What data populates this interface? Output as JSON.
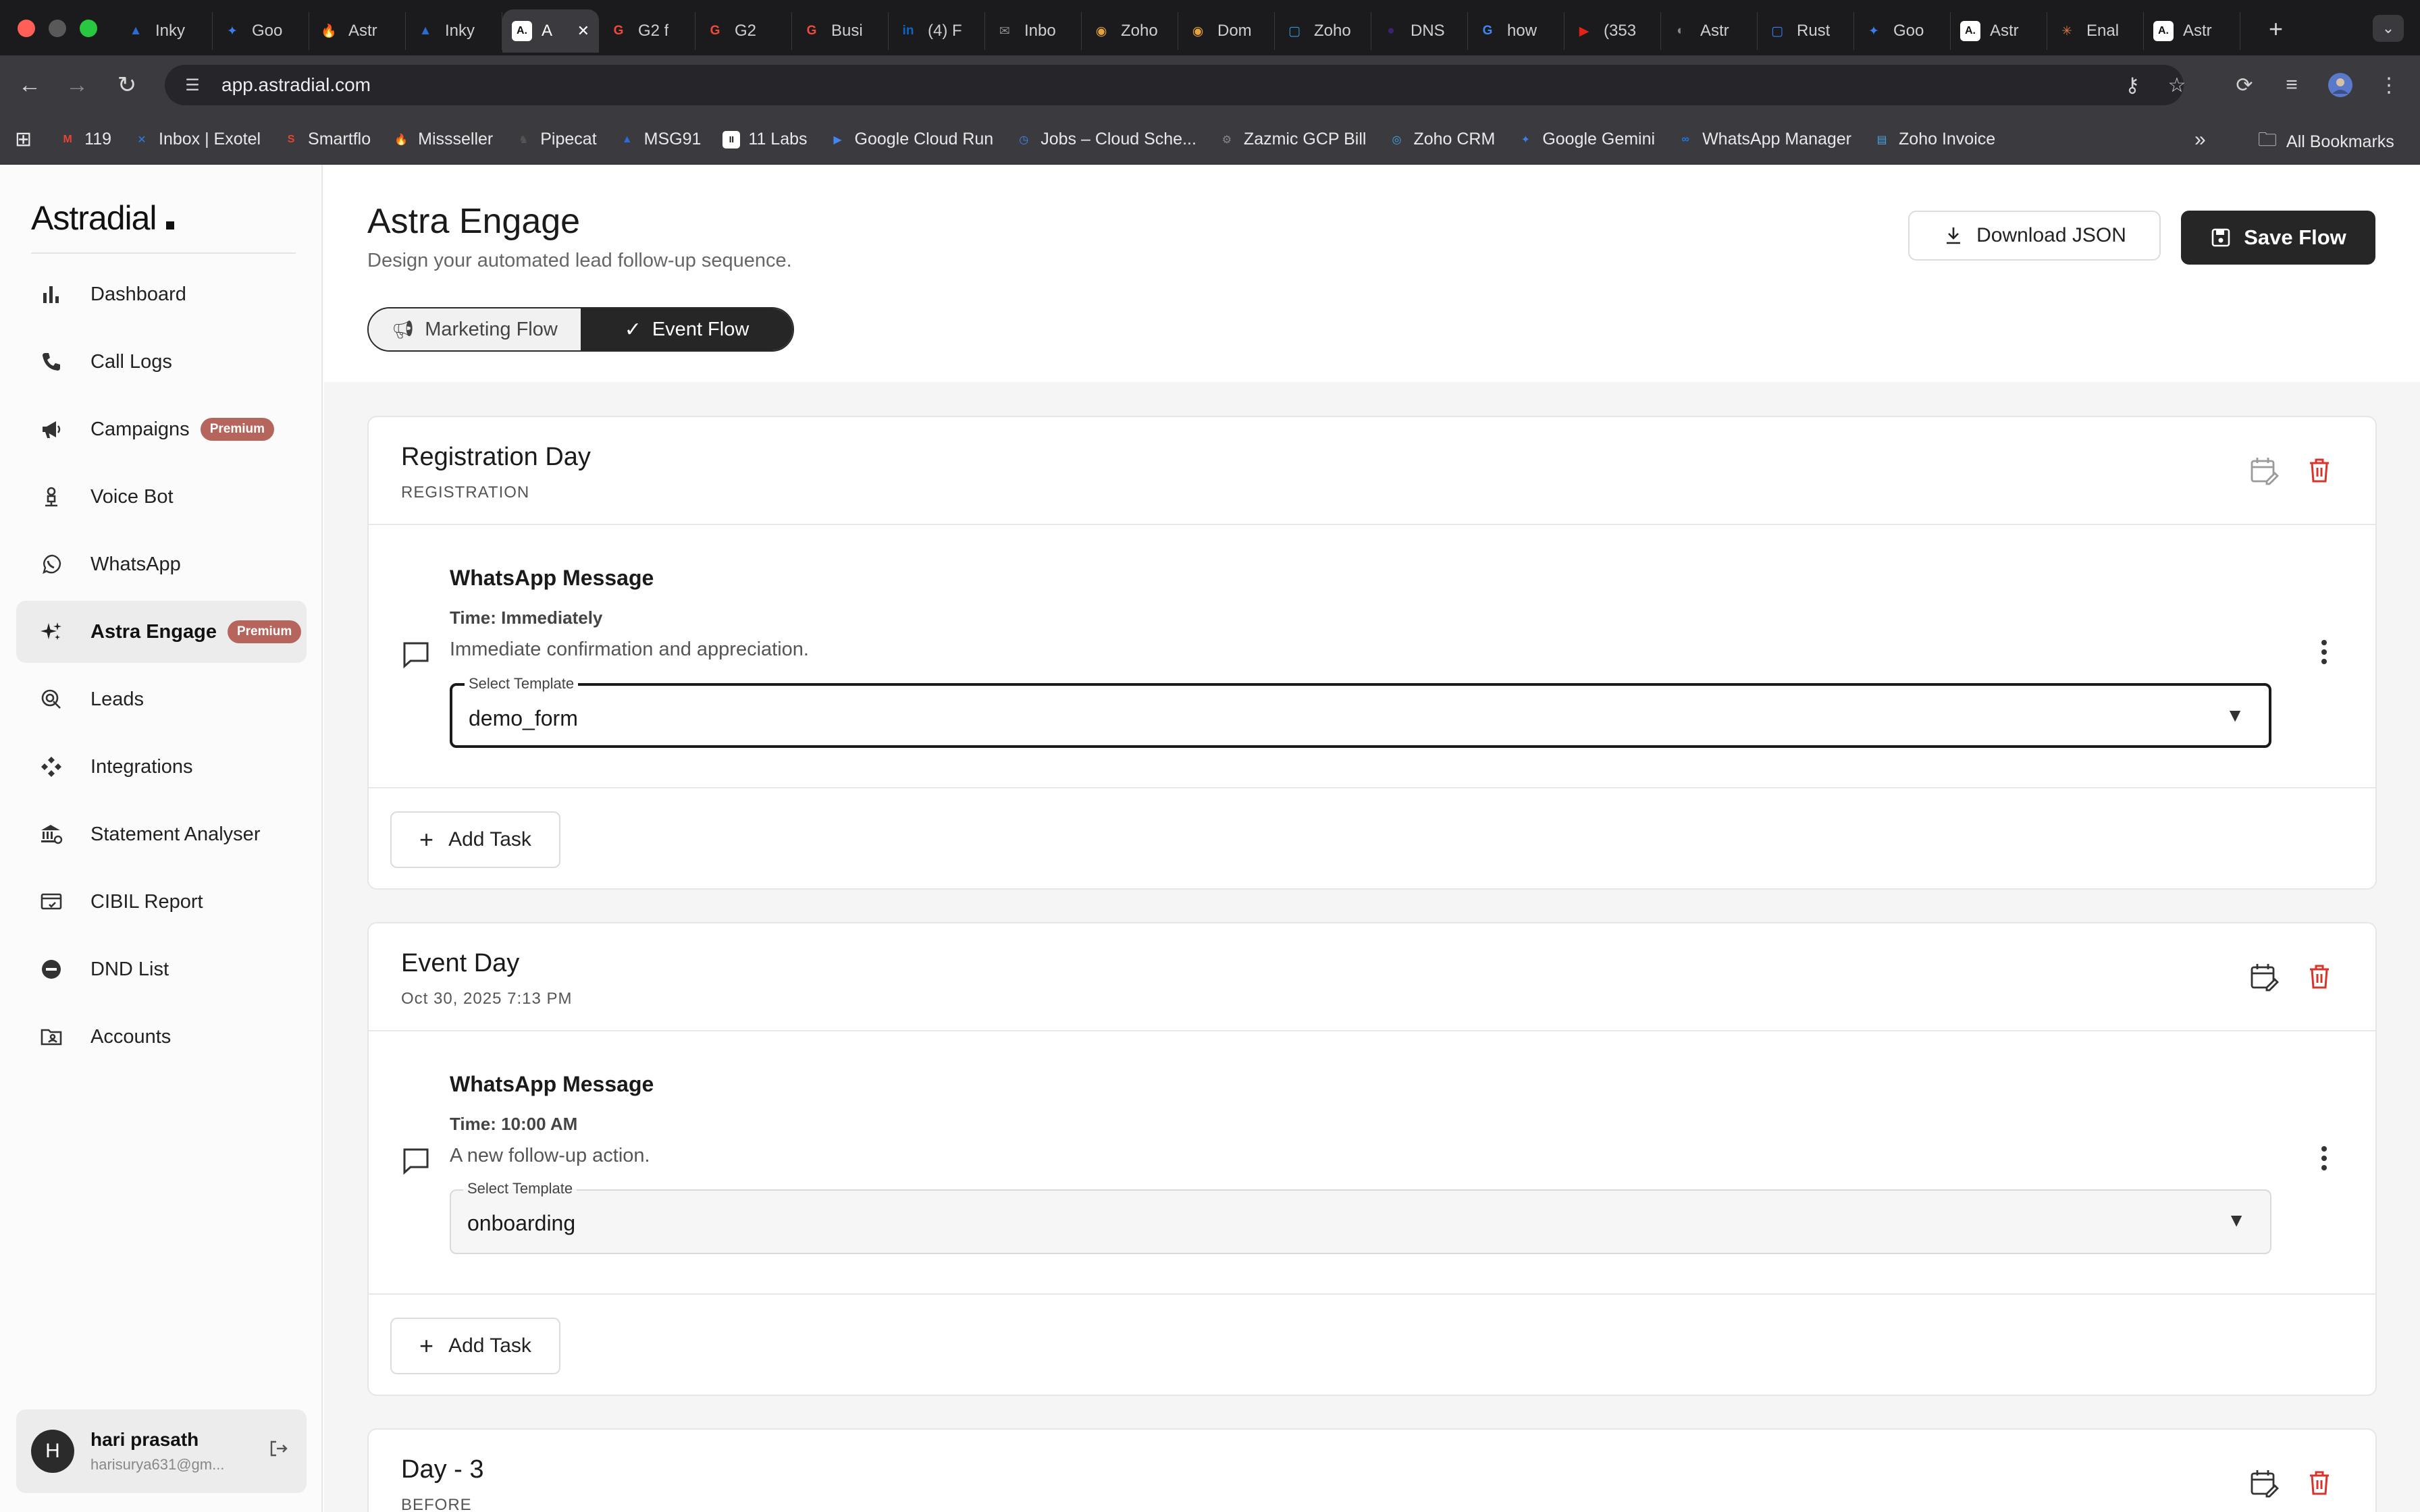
{
  "browser": {
    "tabs": [
      {
        "title": "Inky",
        "fav": "▲",
        "color": "#2a6bd6"
      },
      {
        "title": "Goo",
        "fav": "✦",
        "color": "#3b7ded"
      },
      {
        "title": "Astr",
        "fav": "🔥",
        "color": "#d35400"
      },
      {
        "title": "Inky",
        "fav": "▲",
        "color": "#2a6bd6"
      },
      {
        "title": "A",
        "fav": "A.",
        "color": "#ffffff",
        "active": true
      },
      {
        "title": "G2 f",
        "fav": "G",
        "color": "#ef4a3c"
      },
      {
        "title": "G2",
        "fav": "G",
        "color": "#ef4a3c"
      },
      {
        "title": "Busi",
        "fav": "G",
        "color": "#ef4a3c"
      },
      {
        "title": "(4) F",
        "fav": "in",
        "color": "#0a66c2"
      },
      {
        "title": "Inbo",
        "fav": "✉",
        "color": "#8a8a8a"
      },
      {
        "title": "Zoho",
        "fav": "◉",
        "color": "#e8a33b"
      },
      {
        "title": "Dom",
        "fav": "◉",
        "color": "#e8a33b"
      },
      {
        "title": "Zoho",
        "fav": "▢",
        "color": "#2d9cdb"
      },
      {
        "title": "DNS",
        "fav": "●",
        "color": "#3a2270"
      },
      {
        "title": "how",
        "fav": "G",
        "color": "#4285f4"
      },
      {
        "title": "(353",
        "fav": "▶",
        "color": "#e62117"
      },
      {
        "title": "Astr",
        "fav": "◐",
        "color": "#888888"
      },
      {
        "title": "Rust",
        "fav": "▢",
        "color": "#3b7ded"
      },
      {
        "title": "Goo",
        "fav": "✦",
        "color": "#3b7ded"
      },
      {
        "title": "Astr",
        "fav": "A.",
        "color": "#ffffff"
      },
      {
        "title": "Enal",
        "fav": "✳",
        "color": "#d97745"
      },
      {
        "title": "Astr",
        "fav": "A.",
        "color": "#ffffff"
      }
    ],
    "url": "app.astradial.com",
    "bookmarks": [
      {
        "label": "119",
        "fav": "M",
        "color": "#ea4335"
      },
      {
        "label": "Inbox | Exotel",
        "fav": "✕",
        "color": "#2d7be5"
      },
      {
        "label": "Smartflo",
        "fav": "S",
        "color": "#e2452f"
      },
      {
        "label": "Missseller",
        "fav": "🔥",
        "color": "#d35400"
      },
      {
        "label": "Pipecat",
        "fav": "♞",
        "color": "#555555"
      },
      {
        "label": "MSG91",
        "fav": "▲",
        "color": "#2a6bd6"
      },
      {
        "label": "11 Labs",
        "fav": "II",
        "color": "#ffffff"
      },
      {
        "label": "Google Cloud Run",
        "fav": "▶",
        "color": "#4285f4"
      },
      {
        "label": "Jobs – Cloud Sche...",
        "fav": "◷",
        "color": "#4285f4"
      },
      {
        "label": "Zazmic GCP Bill",
        "fav": "⚙",
        "color": "#888888"
      },
      {
        "label": "Zoho CRM",
        "fav": "◎",
        "color": "#4aa3df"
      },
      {
        "label": "Google Gemini",
        "fav": "✦",
        "color": "#3b7ded"
      },
      {
        "label": "WhatsApp Manager",
        "fav": "∞",
        "color": "#1877f2"
      },
      {
        "label": "Zoho Invoice",
        "fav": "▤",
        "color": "#4aa3df"
      }
    ],
    "all_bookmarks": "All Bookmarks"
  },
  "sidebar": {
    "logo": "Astradial",
    "items": [
      {
        "label": "Dashboard",
        "icon": "bar-chart-icon"
      },
      {
        "label": "Call Logs",
        "icon": "phone-icon"
      },
      {
        "label": "Campaigns",
        "icon": "megaphone-icon",
        "badge": "Premium"
      },
      {
        "label": "Voice Bot",
        "icon": "bot-icon"
      },
      {
        "label": "WhatsApp",
        "icon": "whatsapp-icon"
      },
      {
        "label": "Astra Engage",
        "icon": "sparkle-icon",
        "badge": "Premium",
        "active": true
      },
      {
        "label": "Leads",
        "icon": "lead-icon"
      },
      {
        "label": "Integrations",
        "icon": "integrations-icon"
      },
      {
        "label": "Statement Analyser",
        "icon": "bank-icon"
      },
      {
        "label": "CIBIL Report",
        "icon": "credit-card-icon"
      },
      {
        "label": "DND List",
        "icon": "dnd-icon"
      },
      {
        "label": "Accounts",
        "icon": "folder-user-icon"
      }
    ],
    "user": {
      "initial": "H",
      "name": "hari prasath",
      "email": "harisurya631@gm..."
    }
  },
  "header": {
    "title": "Astra Engage",
    "subtitle": "Design your automated lead follow-up sequence.",
    "download_label": "Download JSON",
    "save_label": "Save Flow",
    "toggle": {
      "marketing": "Marketing Flow",
      "event": "Event Flow",
      "selected": "event"
    }
  },
  "flow": {
    "cards": [
      {
        "title": "Registration Day",
        "subtitle": "REGISTRATION",
        "task": {
          "title": "WhatsApp Message",
          "time": "Time: Immediately",
          "description": "Immediate confirmation and appreciation.",
          "select_label": "Select Template",
          "select_value": "demo_form",
          "focused": true
        },
        "add_task_label": "Add Task"
      },
      {
        "title": "Event Day",
        "subtitle": "Oct 30, 2025  7:13 PM",
        "task": {
          "title": "WhatsApp Message",
          "time": "Time: 10:00 AM",
          "description": "A new follow-up action.",
          "select_label": "Select Template",
          "select_value": "onboarding",
          "focused": false
        },
        "add_task_label": "Add Task"
      },
      {
        "title": "Day - 3",
        "subtitle": "BEFORE"
      }
    ]
  },
  "colors": {
    "delete_red": "#d9342b",
    "premium_badge": "#b5655b",
    "primary_dark": "#262626"
  }
}
